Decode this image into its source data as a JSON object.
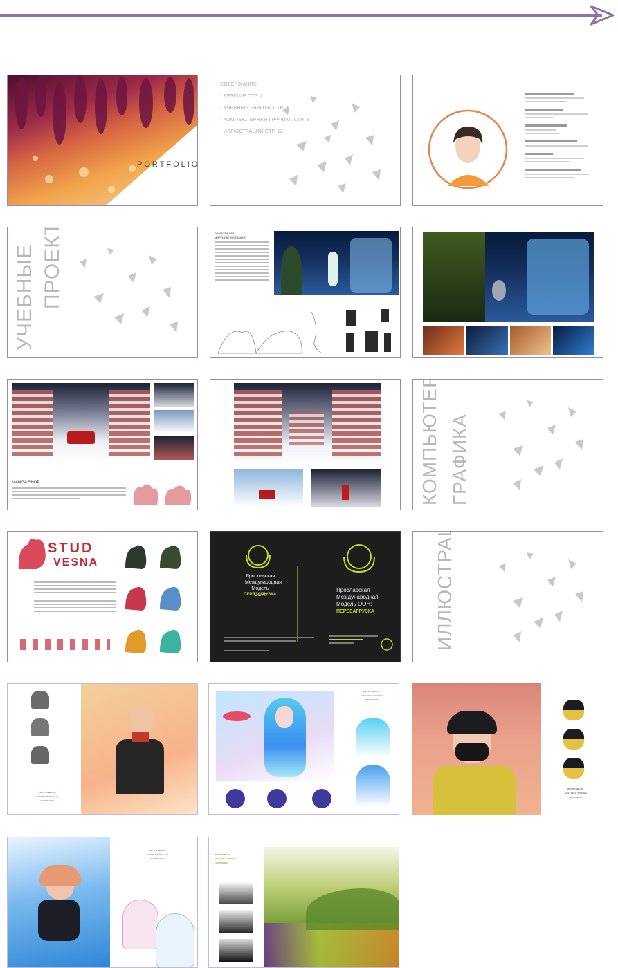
{
  "header": {
    "accent": "#8d74a8",
    "arrow_icon": "arrow-right-icon"
  },
  "cards": {
    "cover": {
      "title": "PORTFOLIO"
    },
    "toc": {
      "heading": "СОДЕРЖАНИЕ:",
      "items": [
        "- РЕЗЮМЕ СТР. 2",
        "- УЧЕБНЫЕ РАБОТЫ СТР. 4",
        "- КОМПЬЮТЕРНАЯ ГРАФИКА СТР. 8",
        "- ИЛЛЮСТРАЦИИ СТР. 12"
      ]
    },
    "edu_section": {
      "word1": "УЧЕБНЫЕ",
      "word2": "ПРОЕКТЫ"
    },
    "exposition": {
      "title": "ЭКСПОЗИЦИЯ",
      "subtitle": "МИР ХАЯО МИЯДЗАКИ"
    },
    "manga": {
      "title": "MANGA SHOP"
    },
    "cg_section": {
      "word1": "КОМПЬЮТЕРНАЯ",
      "word2": "ГРАФИКА"
    },
    "stud": {
      "line1": "STUD",
      "line2": "VESNA"
    },
    "un": {
      "left_title_1": "Ярославская",
      "left_title_2": "Международная",
      "left_title_3": "Модель ООН:",
      "left_accent": "ПЕРЕЗАГРУЗКА",
      "right_title_1": "Ярославская",
      "right_title_2": "Международная",
      "right_title_3": "Модель ООН:",
      "right_accent": "ПЕРЕЗАГРУЗКА",
      "accent_color": "#c4d62a"
    },
    "ill_section": {
      "word1": "ИЛЛЮСТРАЦИИ"
    },
    "tools_1": {
      "label": "ИНСТРУМЕНТЫ:",
      "app1": "EASY PAINT TOOL SAI",
      "app2": "PHOTOSHOP"
    },
    "tools_2": {
      "label": "ИНСТРУМЕНТЫ:",
      "app1": "EASY PAINT TOOL SAI",
      "app2": "PHOTOSHOP"
    },
    "tools_3": {
      "label": "ИНСТРУМЕНТЫ:",
      "app1": "EASY PAINT TOOL SAI",
      "app2": "PHOTOSHOP"
    },
    "tools_4": {
      "label": "ИНСТРУМЕНТЫ:",
      "app1": "EASY PAINT TOOL SAI",
      "app2": "PHOTOSHOP"
    },
    "tools_5": {
      "label": "ИНСТРУМЕНТЫ:",
      "app1": "EASY PAINT TOOL SAI",
      "app2": "PHOTOSHOP"
    }
  }
}
